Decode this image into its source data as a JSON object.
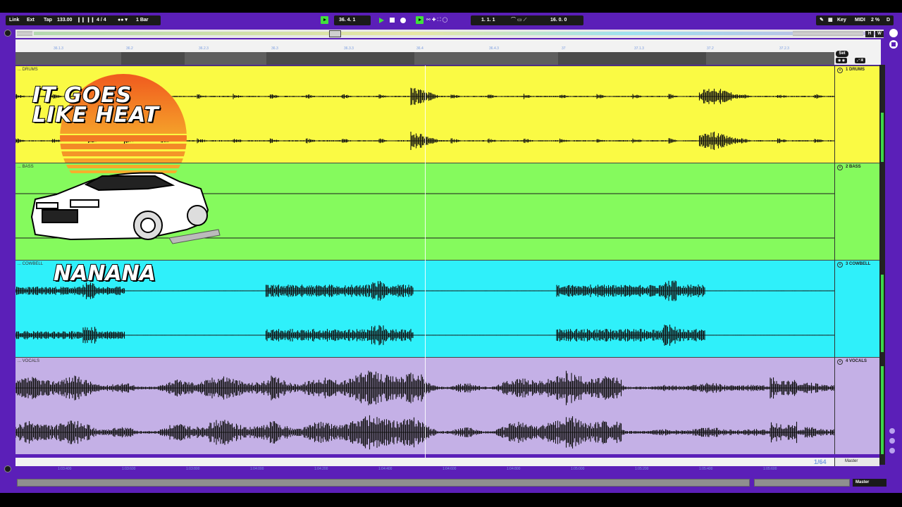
{
  "topbar": {
    "link": "Link",
    "ext": "Ext",
    "tap": "Tap",
    "tempo": "133.00",
    "meter": "4 / 4",
    "quantize": "1 Bar",
    "position": "36.  4.  1",
    "loop_start": "1.   1.   1",
    "loop_length": "16.   0.   0",
    "key": "Key",
    "midi": "MIDI",
    "cpu": "2 %",
    "disk": "D"
  },
  "overview": {
    "h": "H",
    "w": "W"
  },
  "ruler": {
    "labels": [
      "36.1.3",
      "36.2",
      "36.2.3",
      "36.3",
      "36.3.3",
      "36.4",
      "36.4.3",
      "37",
      "37.1.3",
      "37.2",
      "37.2.3"
    ]
  },
  "set_label": "Set",
  "tracks": [
    {
      "clip_label": "... DRUMS",
      "header": "1 DRUMS",
      "color": "#fafa44"
    },
    {
      "clip_label": "... BASS",
      "header": "2 BASS",
      "color": "#85fa5d"
    },
    {
      "clip_label": "... COWBELL",
      "header": "3 COWBELL",
      "color": "#2ff0fa"
    },
    {
      "clip_label": "... VOCALS",
      "header": "4 VOCALS",
      "color": "#c4b0e6"
    }
  ],
  "bottom_ruler": {
    "labels": [
      "1:03:400",
      "1:03:600",
      "1:03:800",
      "1:04:000",
      "1:04:200",
      "1:04:400",
      "1:04:600",
      "1:04:800",
      "1:05:000",
      "1:05:200",
      "1:05:400",
      "1:05:600"
    ],
    "zoom": "1/64"
  },
  "master_track": "Master",
  "status": {
    "master_select": "Master"
  },
  "overlay": {
    "title": "IT GOES\nLIKE HEAT",
    "subtitle": "NANANA"
  },
  "icons": [
    "settings-gear-icon",
    "list-icon",
    "menu-icon",
    "record-dot-icon",
    "play-icon",
    "stop-icon",
    "pencil-icon",
    "keyboard-icon"
  ]
}
